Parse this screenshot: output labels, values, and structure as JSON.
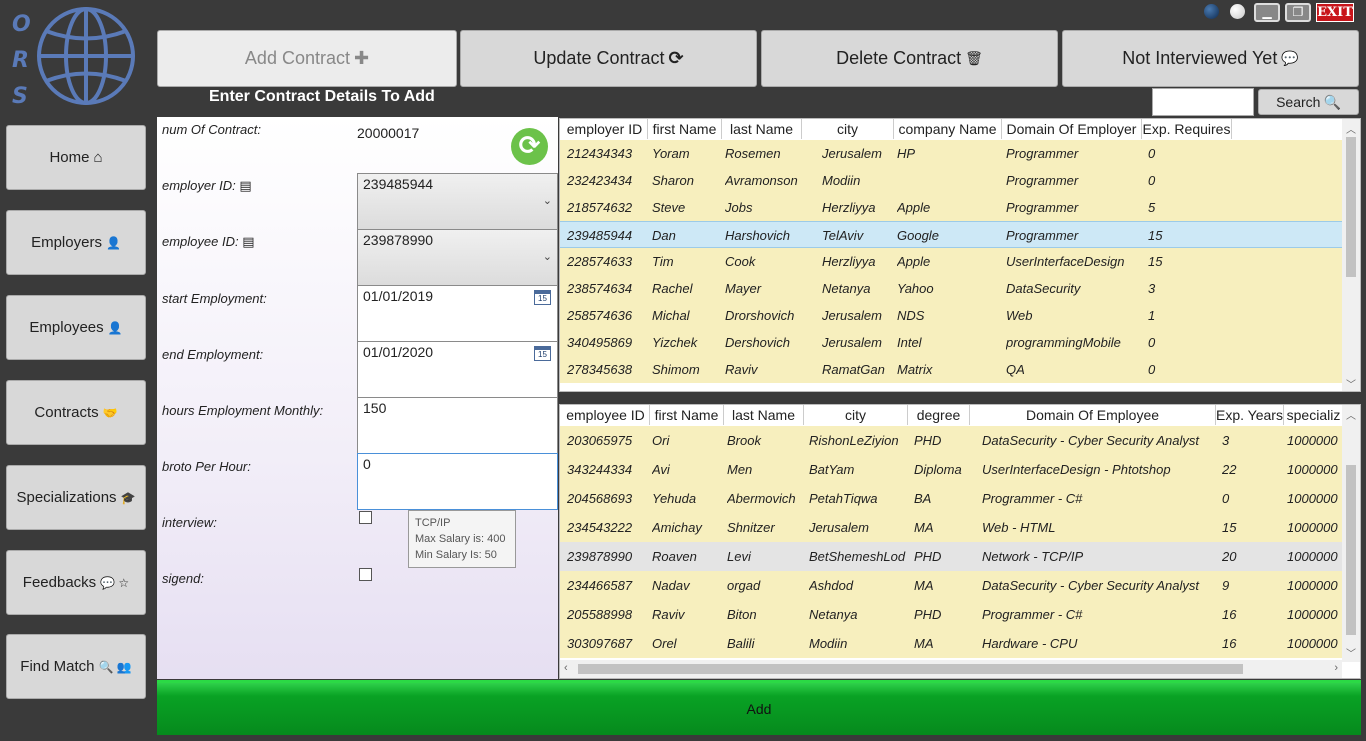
{
  "logo": {
    "letters": [
      "O",
      "R",
      "S"
    ]
  },
  "window_controls": {
    "exit_label": "EXIT"
  },
  "tabs": [
    {
      "label": "Add Contract",
      "icon": "plus-icon",
      "glyph": "✚"
    },
    {
      "label": "Update Contract",
      "icon": "refresh-icon",
      "glyph": "⟳"
    },
    {
      "label": "Delete Contract",
      "icon": "trash-icon",
      "glyph": "🗑"
    },
    {
      "label": "Not Interviewed Yet",
      "icon": "comments-icon",
      "glyph": "💬"
    }
  ],
  "sidebar": [
    {
      "label": "Home",
      "glyph": "⌂"
    },
    {
      "label": "Employers",
      "glyph": "👤"
    },
    {
      "label": "Employees",
      "glyph": "👤"
    },
    {
      "label": "Contracts",
      "glyph": "🤝"
    },
    {
      "label": "Specializations",
      "glyph": "🎓"
    },
    {
      "label": "Feedbacks",
      "glyph": "💬 ☆"
    },
    {
      "label": "Find Match",
      "glyph": "🔍 👥"
    }
  ],
  "form": {
    "heading": "Enter Contract Details To Add",
    "num_label": "num Of Contract:",
    "num_value": "20000017",
    "employer_label": "employer ID:",
    "employer_value": "239485944",
    "employee_label": "employee ID:",
    "employee_value": "239878990",
    "start_label": "start Employment:",
    "start_value": "01/01/2019",
    "end_label": "end Employment:",
    "end_value": "01/01/2020",
    "hours_label": "hours Employment Monthly:",
    "hours_value": "150",
    "broto_label": "broto Per Hour:",
    "broto_value": "0",
    "interview_label": "interview:",
    "signed_label": "sigend:",
    "calendar_day": "15",
    "tooltip": [
      "TCP/IP",
      "Max Salary is: 400",
      "Min Salary Is: 50"
    ]
  },
  "search": {
    "button_label": "Search",
    "value": ""
  },
  "employers_grid": {
    "columns": [
      "employer ID",
      "first Name",
      "last Name",
      "city",
      "company Name",
      "Domain Of Employer",
      "Exp. Requires"
    ],
    "rows": [
      [
        "212434343",
        "Yoram",
        "Rosemen",
        "Jerusalem",
        "HP",
        "Programmer",
        "0"
      ],
      [
        "232423434",
        "Sharon",
        "Avramonson",
        "Modiin",
        "",
        "Programmer",
        "0"
      ],
      [
        "218574632",
        "Steve",
        "Jobs",
        "Herzliyya",
        "Apple",
        "Programmer",
        "5"
      ],
      [
        "239485944",
        "Dan",
        "Harshovich",
        "TelAviv",
        "Google",
        "Programmer",
        "15"
      ],
      [
        "228574633",
        "Tim",
        "Cook",
        "Herzliyya",
        "Apple",
        "UserInterfaceDesign",
        "15"
      ],
      [
        "238574634",
        "Rachel",
        "Mayer",
        "Netanya",
        "Yahoo",
        "DataSecurity",
        "3"
      ],
      [
        "258574636",
        "Michal",
        "Drorshovich",
        "Jerusalem",
        "NDS",
        "Web",
        "1"
      ],
      [
        "340495869",
        "Yizchek",
        "Dershovich",
        "Jerusalem",
        "Intel",
        "programmingMobile",
        "0"
      ],
      [
        "278345638",
        "Shimom",
        "Raviv",
        "RamatGan",
        "Matrix",
        "QA",
        "0"
      ]
    ],
    "selected_index": 3
  },
  "employees_grid": {
    "columns": [
      "employee ID",
      "first Name",
      "last Name",
      "city",
      "degree",
      "Domain Of Employee",
      "Exp. Years",
      "specializ"
    ],
    "rows": [
      [
        "203065975",
        "Ori",
        "Brook",
        "RishonLeZiyion",
        "PHD",
        "DataSecurity - Cyber Security Analyst",
        "3",
        "1000000"
      ],
      [
        "343244334",
        "Avi",
        "Men",
        "BatYam",
        "Diploma",
        "UserInterfaceDesign - Phtotshop",
        "22",
        "1000000"
      ],
      [
        "204568693",
        "Yehuda",
        "Abermovich",
        "PetahTiqwa",
        "BA",
        "Programmer - C#",
        "0",
        "1000000"
      ],
      [
        "234543222",
        "Amichay",
        "Shnitzer",
        "Jerusalem",
        "MA",
        "Web - HTML",
        "15",
        "1000000"
      ],
      [
        "239878990",
        "Roaven",
        "Levi",
        "BetShemeshLod",
        "PHD",
        "Network - TCP/IP",
        "20",
        "1000000"
      ],
      [
        "234466587",
        "Nadav",
        "orgad",
        "Ashdod",
        "MA",
        "DataSecurity - Cyber Security Analyst",
        "9",
        "1000000"
      ],
      [
        "205588998",
        "Raviv",
        "Biton",
        "Netanya",
        "PHD",
        "Programmer - C#",
        "16",
        "1000000"
      ],
      [
        "303097687",
        "Orel",
        "Balili",
        "Modiin",
        "MA",
        "Hardware - CPU",
        "16",
        "1000000"
      ]
    ],
    "selected_index": 4
  },
  "add_button": {
    "label": "Add"
  },
  "colors": {
    "accent_green": "#09a224",
    "row_yellow": "#f7efbe",
    "selected_blue": "#cde8f6",
    "logo_blue": "#5a7ab8"
  }
}
